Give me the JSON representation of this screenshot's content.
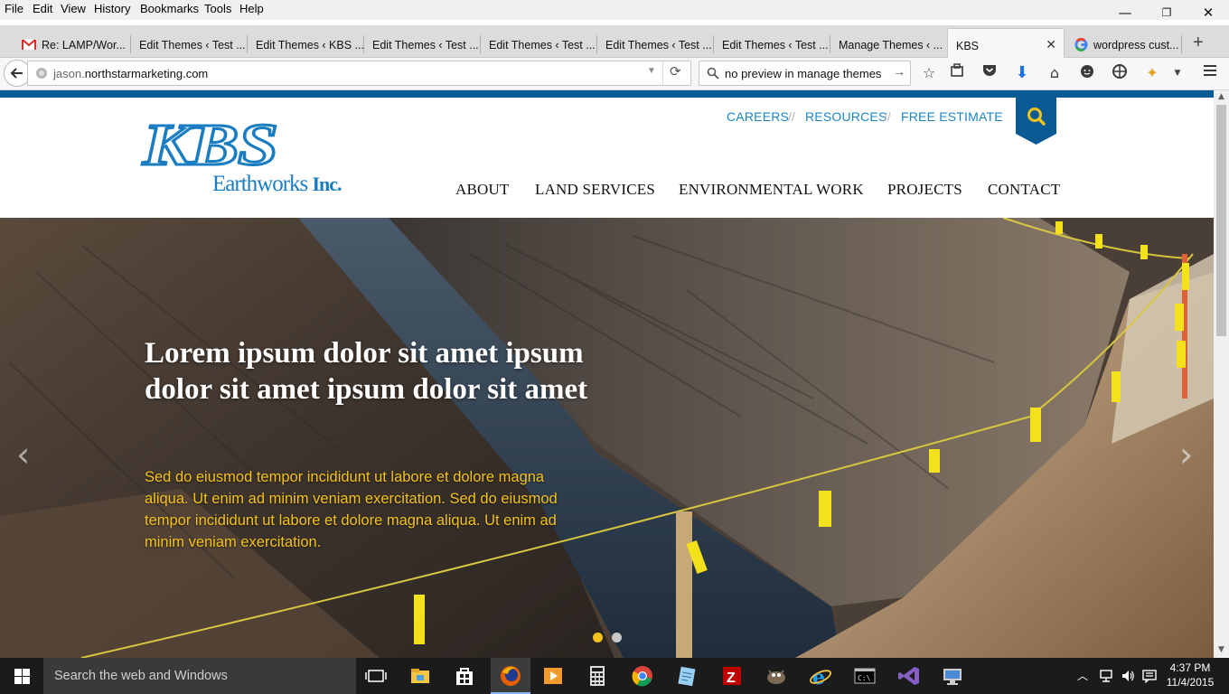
{
  "menu": [
    "File",
    "Edit",
    "View",
    "History",
    "Bookmarks",
    "Tools",
    "Help"
  ],
  "window_controls": {
    "minimize": "—",
    "restore": "❐",
    "close": "✕"
  },
  "tabs": [
    {
      "label": "Re: LAMP/Wor...",
      "icon": "gmail-icon"
    },
    {
      "label": "Edit Themes ‹ Test ..."
    },
    {
      "label": "Edit Themes ‹ KBS ..."
    },
    {
      "label": "Edit Themes ‹ Test ..."
    },
    {
      "label": "Edit Themes ‹ Test ..."
    },
    {
      "label": "Edit Themes ‹ Test ..."
    },
    {
      "label": "Edit Themes ‹ Test ..."
    },
    {
      "label": "Manage Themes ‹ ..."
    },
    {
      "label": "KBS",
      "active": true
    },
    {
      "label": "wordpress cust...",
      "icon": "google-icon"
    }
  ],
  "new_tab": "+",
  "url": {
    "prefix": "jason.",
    "domain": "northstarmarketing.com"
  },
  "search_value": "no preview in manage themes",
  "site": {
    "logo_text": "KBS",
    "logo_sub": "Earthworks",
    "logo_inc": "Inc.",
    "top_links": [
      "CAREERS",
      "RESOURCES",
      "FREE ESTIMATE"
    ],
    "link_sep": "//",
    "nav": [
      "ABOUT",
      "LAND SERVICES",
      "ENVIRONMENTAL WORK",
      "PROJECTS",
      "CONTACT"
    ],
    "hero": {
      "heading": "Lorem ipsum dolor sit amet ipsum dolor sit amet ipsum dolor sit amet",
      "text": "Sed do eiusmod tempor incididunt ut labore et dolore magna aliqua. Ut enim ad minim veniam exercitation. Sed do eiusmod tempor incididunt ut labore et dolore magna aliqua. Ut enim ad minim veniam exercitation.",
      "prev": "‹",
      "next": "›",
      "active_slide": 1,
      "slide_count": 2
    }
  },
  "colors": {
    "brand": "#1a7dc1",
    "navy": "#0a5a96",
    "accent": "#f3c21b"
  },
  "taskbar": {
    "search_placeholder": "Search the web and Windows",
    "time": "4:37 PM",
    "date": "11/4/2015"
  }
}
